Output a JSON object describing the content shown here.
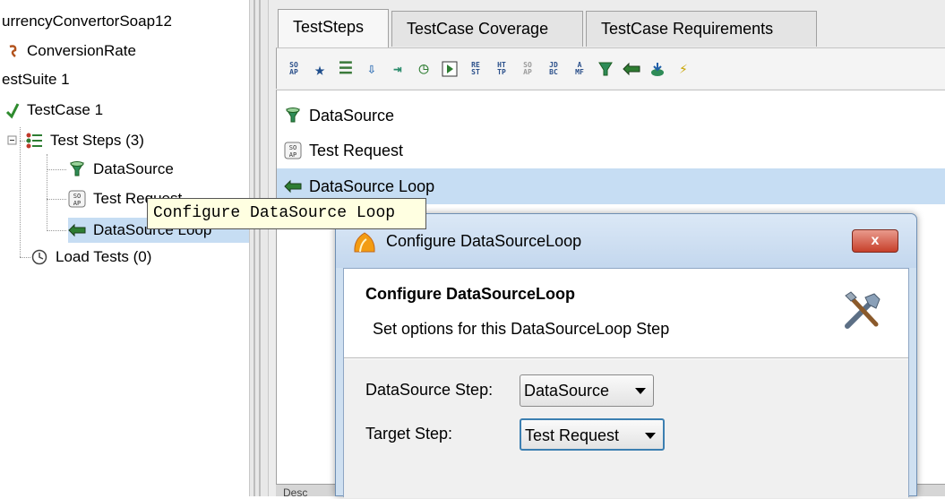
{
  "tree": {
    "items": [
      {
        "label": "urrencyConvertorSoap12"
      },
      {
        "label": "ConversionRate"
      },
      {
        "label": "estSuite 1"
      },
      {
        "label": "TestCase 1"
      },
      {
        "label": "Test Steps (3)"
      },
      {
        "label": "DataSource"
      },
      {
        "label": "Test Request"
      },
      {
        "label": "DataSource Loop"
      },
      {
        "label": "Load Tests (0)"
      }
    ]
  },
  "tabs": [
    {
      "label": "TestSteps"
    },
    {
      "label": "TestCase Coverage"
    },
    {
      "label": "TestCase Requirements"
    }
  ],
  "toolbar": {
    "icons": [
      {
        "name": "soap-request-icon",
        "text": "SO\nAP"
      },
      {
        "name": "star-icon"
      },
      {
        "name": "list-icon"
      },
      {
        "name": "transfer-icon"
      },
      {
        "name": "arrow-icon"
      },
      {
        "name": "clock-icon"
      },
      {
        "name": "run-icon"
      },
      {
        "name": "rest-request-icon",
        "text": "RE\nST"
      },
      {
        "name": "http-request-icon",
        "text": "HT\nTP"
      },
      {
        "name": "soap-mock-icon",
        "text": "SO\nAP"
      },
      {
        "name": "jdbc-request-icon",
        "text": "JD\nBC"
      },
      {
        "name": "amf-request-icon",
        "text": "A\nMF"
      },
      {
        "name": "datasource-icon"
      },
      {
        "name": "datasource-loop-icon"
      },
      {
        "name": "datasink-icon"
      },
      {
        "name": "groovy-icon"
      }
    ]
  },
  "steps": [
    {
      "label": "DataSource"
    },
    {
      "label": "Test Request"
    },
    {
      "label": "DataSource Loop"
    }
  ],
  "tooltip": {
    "text": "Configure DataSource Loop"
  },
  "dialog": {
    "title": "Configure DataSourceLoop",
    "close_label": "x",
    "heading": "Configure DataSourceLoop",
    "subheading": "Set options for this DataSourceLoop Step",
    "fields": {
      "datasource_step_label": "DataSource Step:",
      "datasource_step_value": "DataSource",
      "target_step_label": "Target Step:",
      "target_step_value": "Test Request"
    }
  },
  "bottom": {
    "label": "Desc"
  },
  "colors": {
    "selection": "#c6ddf3",
    "tooltip_bg": "#ffffe1",
    "dialog_frame": "#cfe0f1",
    "close_red": "#c7402b"
  }
}
